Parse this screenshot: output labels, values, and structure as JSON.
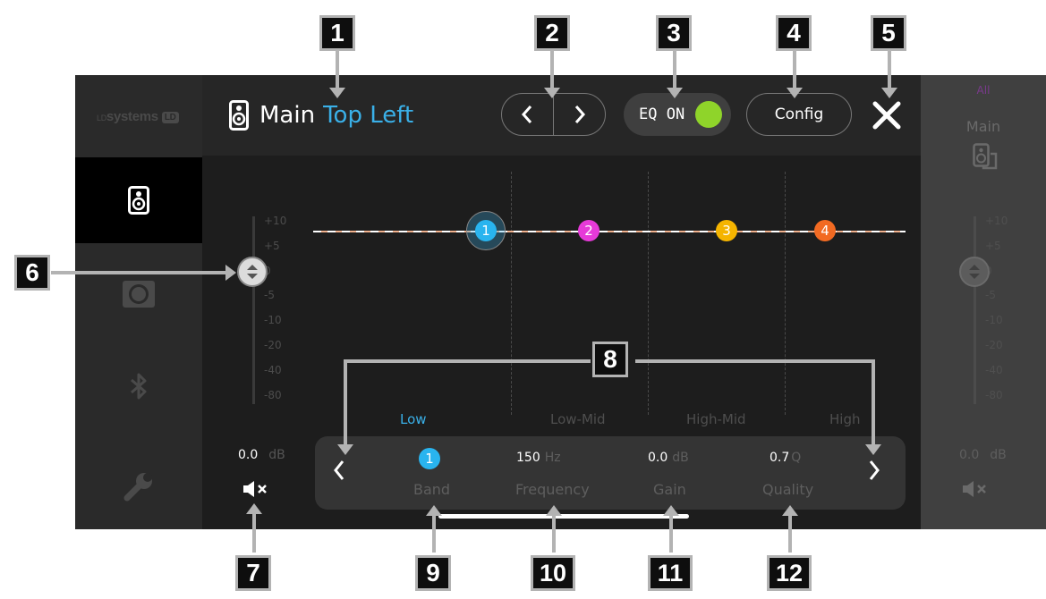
{
  "brand": {
    "prefix": "LD",
    "name": "systems",
    "badge": "LD"
  },
  "header": {
    "title_main": "Main",
    "title_accent": "Top Left",
    "prev_glyph": "‹",
    "next_glyph": "›",
    "eq_label": "EQ ON",
    "eq_enabled": true,
    "config_label": "Config"
  },
  "sidebar": {
    "items": [
      {
        "icon": "speaker-icon",
        "active": true
      },
      {
        "icon": "subwoofer-icon",
        "active": false
      },
      {
        "icon": "bluetooth-icon",
        "active": false
      },
      {
        "icon": "wrench-icon",
        "active": false
      }
    ]
  },
  "fader": {
    "scale": [
      "+10",
      "+5",
      "0",
      "-5",
      "-10",
      "-20",
      "-40",
      "-80"
    ],
    "value": "0.0",
    "unit": "dB",
    "level_db": 0
  },
  "eq": {
    "bands": [
      {
        "num": "1",
        "name": "Low",
        "color": "#29b4ef",
        "selected": true
      },
      {
        "num": "2",
        "name": "Low-Mid",
        "color": "#e63ad8"
      },
      {
        "num": "3",
        "name": "High-Mid",
        "color": "#f5b400"
      },
      {
        "num": "4",
        "name": "High",
        "color": "#f26a22"
      }
    ],
    "curve_color": "#f0b08c"
  },
  "band_panel": {
    "band_num": "1",
    "band_label": "Band",
    "frequency_value": "150",
    "frequency_unit": "Hz",
    "frequency_label": "Frequency",
    "gain_value": "0.0",
    "gain_unit": "dB",
    "gain_label": "Gain",
    "quality_value": "0.7",
    "quality_unit": "Q",
    "quality_label": "Quality"
  },
  "right_panel": {
    "group": "All",
    "zone": "Main",
    "scale": [
      "+10",
      "+5",
      "0",
      "-5",
      "-10",
      "-20",
      "-40",
      "-80"
    ],
    "value": "0.0",
    "unit": "dB"
  },
  "callouts": [
    "1",
    "2",
    "3",
    "4",
    "5",
    "6",
    "7",
    "8",
    "9",
    "10",
    "11",
    "12"
  ],
  "colors": {
    "accent": "#3ab0e8",
    "eq_on": "#8fd42a",
    "background": "#1d1d1d"
  }
}
